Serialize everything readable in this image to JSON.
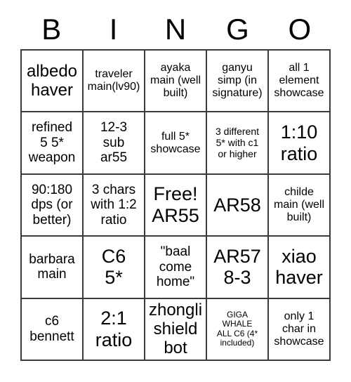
{
  "header": {
    "letters": [
      "B",
      "I",
      "N",
      "G",
      "O"
    ]
  },
  "grid": {
    "rows": 5,
    "columns": 5,
    "border_color": "#3a3a3a",
    "background_color": "#ffffff",
    "text_color": "#000000"
  },
  "cells": [
    {
      "text": "albedo\nhaver",
      "size": "fs-lg",
      "free": false
    },
    {
      "text": "traveler\nmain(lv90)",
      "size": "fs-sm",
      "free": false
    },
    {
      "text": "ayaka\nmain (well\nbuilt)",
      "size": "fs-sm",
      "free": false
    },
    {
      "text": "ganyu\nsimp (in\nsignature)",
      "size": "fs-sm",
      "free": false
    },
    {
      "text": "all 1\nelement\nshowcase",
      "size": "fs-sm",
      "free": false
    },
    {
      "text": "refined\n5 5*\nweapon",
      "size": "fs-md",
      "free": false
    },
    {
      "text": "12-3\nsub\nar55",
      "size": "fs-md",
      "free": false
    },
    {
      "text": "full 5*\nshowcase",
      "size": "fs-sm",
      "free": false
    },
    {
      "text": "3 different\n5* with c1\nor higher",
      "size": "fs-xs",
      "free": false
    },
    {
      "text": "1:10\nratio",
      "size": "fs-xl",
      "free": false
    },
    {
      "text": "90:180\ndps (or\nbetter)",
      "size": "fs-md",
      "free": false
    },
    {
      "text": "3 chars\nwith 1:2\nratio",
      "size": "fs-md",
      "free": false
    },
    {
      "text": "Free!\nAR55",
      "size": "fs-xl",
      "free": true
    },
    {
      "text": "AR58",
      "size": "fs-xl",
      "free": false
    },
    {
      "text": "childe\nmain (well\nbuilt)",
      "size": "fs-sm",
      "free": false
    },
    {
      "text": "barbara\nmain",
      "size": "fs-md",
      "free": false
    },
    {
      "text": "C6\n5*",
      "size": "fs-xl",
      "free": false
    },
    {
      "text": "\"baal\ncome\nhome\"",
      "size": "fs-md",
      "free": false
    },
    {
      "text": "AR57\n8-3",
      "size": "fs-xl",
      "free": false
    },
    {
      "text": "xiao\nhaver",
      "size": "fs-xl",
      "free": false
    },
    {
      "text": "c6\nbennett",
      "size": "fs-md",
      "free": false
    },
    {
      "text": "2:1\nratio",
      "size": "fs-xl",
      "free": false
    },
    {
      "text": "zhongli\nshield\nbot",
      "size": "fs-lg",
      "free": false
    },
    {
      "text": "GIGA\nWHALE\nALL C6 (4*\nincluded)",
      "size": "fs-xxs",
      "free": false
    },
    {
      "text": "only 1\nchar in\nshowcase",
      "size": "fs-sm",
      "free": false
    }
  ]
}
